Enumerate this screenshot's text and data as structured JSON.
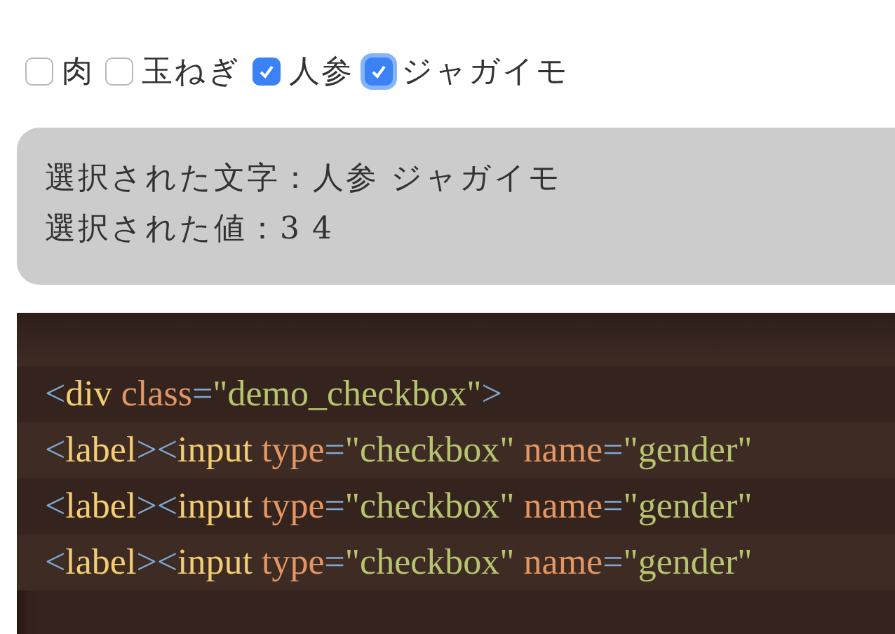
{
  "checkboxes": [
    {
      "label": "肉",
      "checked": false,
      "focused": false
    },
    {
      "label": "玉ねぎ",
      "checked": false,
      "focused": false
    },
    {
      "label": "人参",
      "checked": true,
      "focused": false
    },
    {
      "label": "ジャガイモ",
      "checked": true,
      "focused": true
    }
  ],
  "result": [
    {
      "label": "選択された文字：",
      "value": "人参 ジャガイモ",
      "kind": "text"
    },
    {
      "label": "選択された値：",
      "value": "3 4",
      "kind": "number"
    }
  ],
  "code_lines": [
    [
      {
        "kind": "punct",
        "text": "<"
      },
      {
        "kind": "tag",
        "text": "div"
      },
      {
        "kind": "attr",
        "text": " class"
      },
      {
        "kind": "punct",
        "text": "="
      },
      {
        "kind": "string",
        "text": "\"demo_checkbox\""
      },
      {
        "kind": "punct",
        "text": ">"
      }
    ],
    [
      {
        "kind": "punct",
        "text": "<"
      },
      {
        "kind": "tag",
        "text": "label"
      },
      {
        "kind": "punct",
        "text": "><"
      },
      {
        "kind": "tag",
        "text": "input"
      },
      {
        "kind": "attr",
        "text": " type"
      },
      {
        "kind": "punct",
        "text": "="
      },
      {
        "kind": "string",
        "text": "\"checkbox\""
      },
      {
        "kind": "attr",
        "text": " name"
      },
      {
        "kind": "punct",
        "text": "="
      },
      {
        "kind": "string",
        "text": "\"gender\""
      }
    ],
    [
      {
        "kind": "punct",
        "text": "<"
      },
      {
        "kind": "tag",
        "text": "label"
      },
      {
        "kind": "punct",
        "text": "><"
      },
      {
        "kind": "tag",
        "text": "input"
      },
      {
        "kind": "attr",
        "text": " type"
      },
      {
        "kind": "punct",
        "text": "="
      },
      {
        "kind": "string",
        "text": "\"checkbox\""
      },
      {
        "kind": "attr",
        "text": " name"
      },
      {
        "kind": "punct",
        "text": "="
      },
      {
        "kind": "string",
        "text": "\"gender\""
      }
    ],
    [
      {
        "kind": "punct",
        "text": "<"
      },
      {
        "kind": "tag",
        "text": "label"
      },
      {
        "kind": "punct",
        "text": "><"
      },
      {
        "kind": "tag",
        "text": "input"
      },
      {
        "kind": "attr",
        "text": " type"
      },
      {
        "kind": "punct",
        "text": "="
      },
      {
        "kind": "string",
        "text": "\"checkbox\""
      },
      {
        "kind": "attr",
        "text": " name"
      },
      {
        "kind": "punct",
        "text": "="
      },
      {
        "kind": "string",
        "text": "\"gender\""
      }
    ]
  ]
}
